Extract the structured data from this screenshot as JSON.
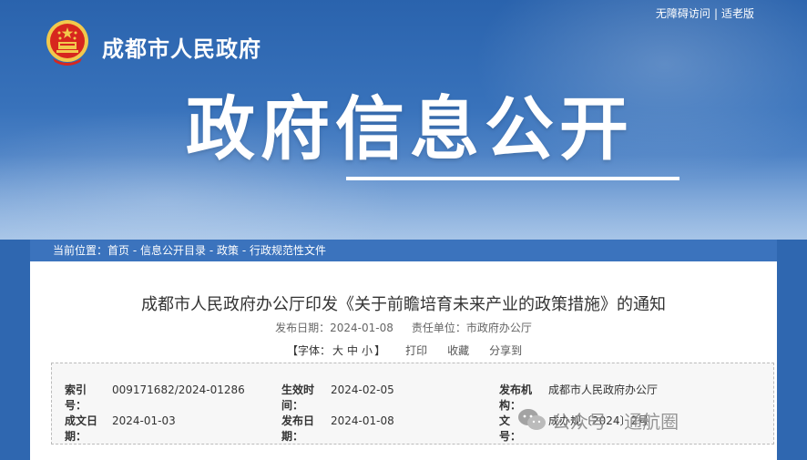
{
  "header": {
    "site_title": "成都市人民政府",
    "top_links": [
      "无障碍访问",
      "适老版"
    ],
    "top_links_separator": "|",
    "banner_title": "政府信息公开"
  },
  "breadcrumb": {
    "prefix": "当前位置：",
    "items": [
      "首页",
      "信息公开目录",
      "政策",
      "行政规范性文件"
    ],
    "separator": " - "
  },
  "document": {
    "title": "成都市人民政府办公厅印发《关于前瞻培育未来产业的政策措施》的通知",
    "publish_date_label": "发布日期：",
    "publish_date": "2024-01-08",
    "unit_label": "责任单位：",
    "unit": "市政府办公厅",
    "font_size_label_open": "【字体：",
    "font_sizes": [
      "大",
      "中",
      "小"
    ],
    "font_size_label_close": "】",
    "print_label": "打印",
    "favorite_label": "收藏",
    "share_label": "分享到"
  },
  "info": {
    "index_no_label": [
      "索引",
      "号："
    ],
    "index_no": "009171682/2024-01286",
    "effective_label": [
      "生效时",
      "间："
    ],
    "effective_date": "2024-02-05",
    "issuer_label": [
      "发布机",
      "构："
    ],
    "issuer": "成都市人民政府办公厅",
    "written_label": [
      "成文日",
      "期："
    ],
    "written_date": "2024-01-03",
    "pub_label": [
      "发布日",
      "期："
    ],
    "pub_date": "2024-01-08",
    "doc_no_label": [
      "文",
      "号："
    ],
    "doc_no": "成办规〔2024〕2号"
  },
  "watermark": {
    "text": "公众号 · 通航圈",
    "icon": "wechat-icon"
  },
  "colors": {
    "banner_blue": "#2f67b0",
    "breadcrumb_bar": "#3b73bd",
    "emblem_red": "#d7261e",
    "emblem_gold": "#f2c94c"
  }
}
